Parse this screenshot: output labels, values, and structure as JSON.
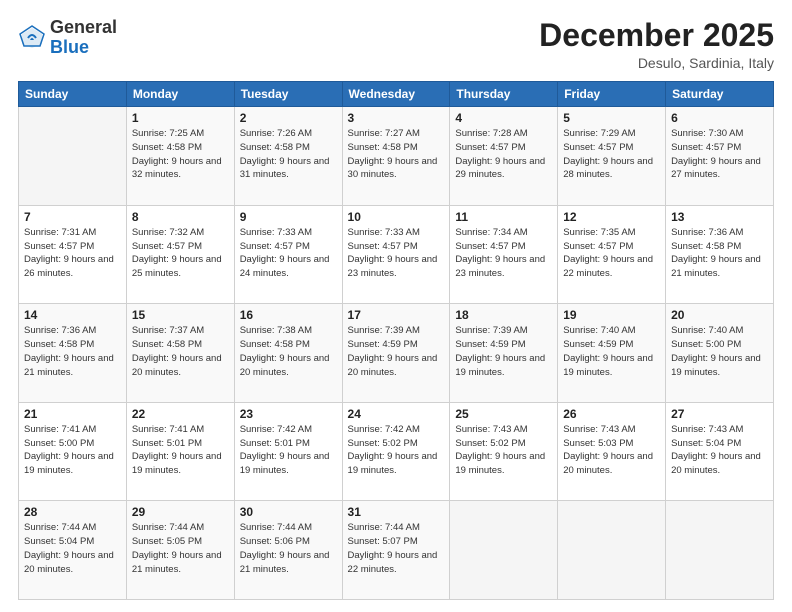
{
  "logo": {
    "general": "General",
    "blue": "Blue"
  },
  "header": {
    "month": "December 2025",
    "location": "Desulo, Sardinia, Italy"
  },
  "weekdays": [
    "Sunday",
    "Monday",
    "Tuesday",
    "Wednesday",
    "Thursday",
    "Friday",
    "Saturday"
  ],
  "weeks": [
    [
      {
        "day": "",
        "sunrise": "",
        "sunset": "",
        "daylight": ""
      },
      {
        "day": "1",
        "sunrise": "Sunrise: 7:25 AM",
        "sunset": "Sunset: 4:58 PM",
        "daylight": "Daylight: 9 hours and 32 minutes."
      },
      {
        "day": "2",
        "sunrise": "Sunrise: 7:26 AM",
        "sunset": "Sunset: 4:58 PM",
        "daylight": "Daylight: 9 hours and 31 minutes."
      },
      {
        "day": "3",
        "sunrise": "Sunrise: 7:27 AM",
        "sunset": "Sunset: 4:58 PM",
        "daylight": "Daylight: 9 hours and 30 minutes."
      },
      {
        "day": "4",
        "sunrise": "Sunrise: 7:28 AM",
        "sunset": "Sunset: 4:57 PM",
        "daylight": "Daylight: 9 hours and 29 minutes."
      },
      {
        "day": "5",
        "sunrise": "Sunrise: 7:29 AM",
        "sunset": "Sunset: 4:57 PM",
        "daylight": "Daylight: 9 hours and 28 minutes."
      },
      {
        "day": "6",
        "sunrise": "Sunrise: 7:30 AM",
        "sunset": "Sunset: 4:57 PM",
        "daylight": "Daylight: 9 hours and 27 minutes."
      }
    ],
    [
      {
        "day": "7",
        "sunrise": "Sunrise: 7:31 AM",
        "sunset": "Sunset: 4:57 PM",
        "daylight": "Daylight: 9 hours and 26 minutes."
      },
      {
        "day": "8",
        "sunrise": "Sunrise: 7:32 AM",
        "sunset": "Sunset: 4:57 PM",
        "daylight": "Daylight: 9 hours and 25 minutes."
      },
      {
        "day": "9",
        "sunrise": "Sunrise: 7:33 AM",
        "sunset": "Sunset: 4:57 PM",
        "daylight": "Daylight: 9 hours and 24 minutes."
      },
      {
        "day": "10",
        "sunrise": "Sunrise: 7:33 AM",
        "sunset": "Sunset: 4:57 PM",
        "daylight": "Daylight: 9 hours and 23 minutes."
      },
      {
        "day": "11",
        "sunrise": "Sunrise: 7:34 AM",
        "sunset": "Sunset: 4:57 PM",
        "daylight": "Daylight: 9 hours and 23 minutes."
      },
      {
        "day": "12",
        "sunrise": "Sunrise: 7:35 AM",
        "sunset": "Sunset: 4:57 PM",
        "daylight": "Daylight: 9 hours and 22 minutes."
      },
      {
        "day": "13",
        "sunrise": "Sunrise: 7:36 AM",
        "sunset": "Sunset: 4:58 PM",
        "daylight": "Daylight: 9 hours and 21 minutes."
      }
    ],
    [
      {
        "day": "14",
        "sunrise": "Sunrise: 7:36 AM",
        "sunset": "Sunset: 4:58 PM",
        "daylight": "Daylight: 9 hours and 21 minutes."
      },
      {
        "day": "15",
        "sunrise": "Sunrise: 7:37 AM",
        "sunset": "Sunset: 4:58 PM",
        "daylight": "Daylight: 9 hours and 20 minutes."
      },
      {
        "day": "16",
        "sunrise": "Sunrise: 7:38 AM",
        "sunset": "Sunset: 4:58 PM",
        "daylight": "Daylight: 9 hours and 20 minutes."
      },
      {
        "day": "17",
        "sunrise": "Sunrise: 7:39 AM",
        "sunset": "Sunset: 4:59 PM",
        "daylight": "Daylight: 9 hours and 20 minutes."
      },
      {
        "day": "18",
        "sunrise": "Sunrise: 7:39 AM",
        "sunset": "Sunset: 4:59 PM",
        "daylight": "Daylight: 9 hours and 19 minutes."
      },
      {
        "day": "19",
        "sunrise": "Sunrise: 7:40 AM",
        "sunset": "Sunset: 4:59 PM",
        "daylight": "Daylight: 9 hours and 19 minutes."
      },
      {
        "day": "20",
        "sunrise": "Sunrise: 7:40 AM",
        "sunset": "Sunset: 5:00 PM",
        "daylight": "Daylight: 9 hours and 19 minutes."
      }
    ],
    [
      {
        "day": "21",
        "sunrise": "Sunrise: 7:41 AM",
        "sunset": "Sunset: 5:00 PM",
        "daylight": "Daylight: 9 hours and 19 minutes."
      },
      {
        "day": "22",
        "sunrise": "Sunrise: 7:41 AM",
        "sunset": "Sunset: 5:01 PM",
        "daylight": "Daylight: 9 hours and 19 minutes."
      },
      {
        "day": "23",
        "sunrise": "Sunrise: 7:42 AM",
        "sunset": "Sunset: 5:01 PM",
        "daylight": "Daylight: 9 hours and 19 minutes."
      },
      {
        "day": "24",
        "sunrise": "Sunrise: 7:42 AM",
        "sunset": "Sunset: 5:02 PM",
        "daylight": "Daylight: 9 hours and 19 minutes."
      },
      {
        "day": "25",
        "sunrise": "Sunrise: 7:43 AM",
        "sunset": "Sunset: 5:02 PM",
        "daylight": "Daylight: 9 hours and 19 minutes."
      },
      {
        "day": "26",
        "sunrise": "Sunrise: 7:43 AM",
        "sunset": "Sunset: 5:03 PM",
        "daylight": "Daylight: 9 hours and 20 minutes."
      },
      {
        "day": "27",
        "sunrise": "Sunrise: 7:43 AM",
        "sunset": "Sunset: 5:04 PM",
        "daylight": "Daylight: 9 hours and 20 minutes."
      }
    ],
    [
      {
        "day": "28",
        "sunrise": "Sunrise: 7:44 AM",
        "sunset": "Sunset: 5:04 PM",
        "daylight": "Daylight: 9 hours and 20 minutes."
      },
      {
        "day": "29",
        "sunrise": "Sunrise: 7:44 AM",
        "sunset": "Sunset: 5:05 PM",
        "daylight": "Daylight: 9 hours and 21 minutes."
      },
      {
        "day": "30",
        "sunrise": "Sunrise: 7:44 AM",
        "sunset": "Sunset: 5:06 PM",
        "daylight": "Daylight: 9 hours and 21 minutes."
      },
      {
        "day": "31",
        "sunrise": "Sunrise: 7:44 AM",
        "sunset": "Sunset: 5:07 PM",
        "daylight": "Daylight: 9 hours and 22 minutes."
      },
      {
        "day": "",
        "sunrise": "",
        "sunset": "",
        "daylight": ""
      },
      {
        "day": "",
        "sunrise": "",
        "sunset": "",
        "daylight": ""
      },
      {
        "day": "",
        "sunrise": "",
        "sunset": "",
        "daylight": ""
      }
    ]
  ]
}
